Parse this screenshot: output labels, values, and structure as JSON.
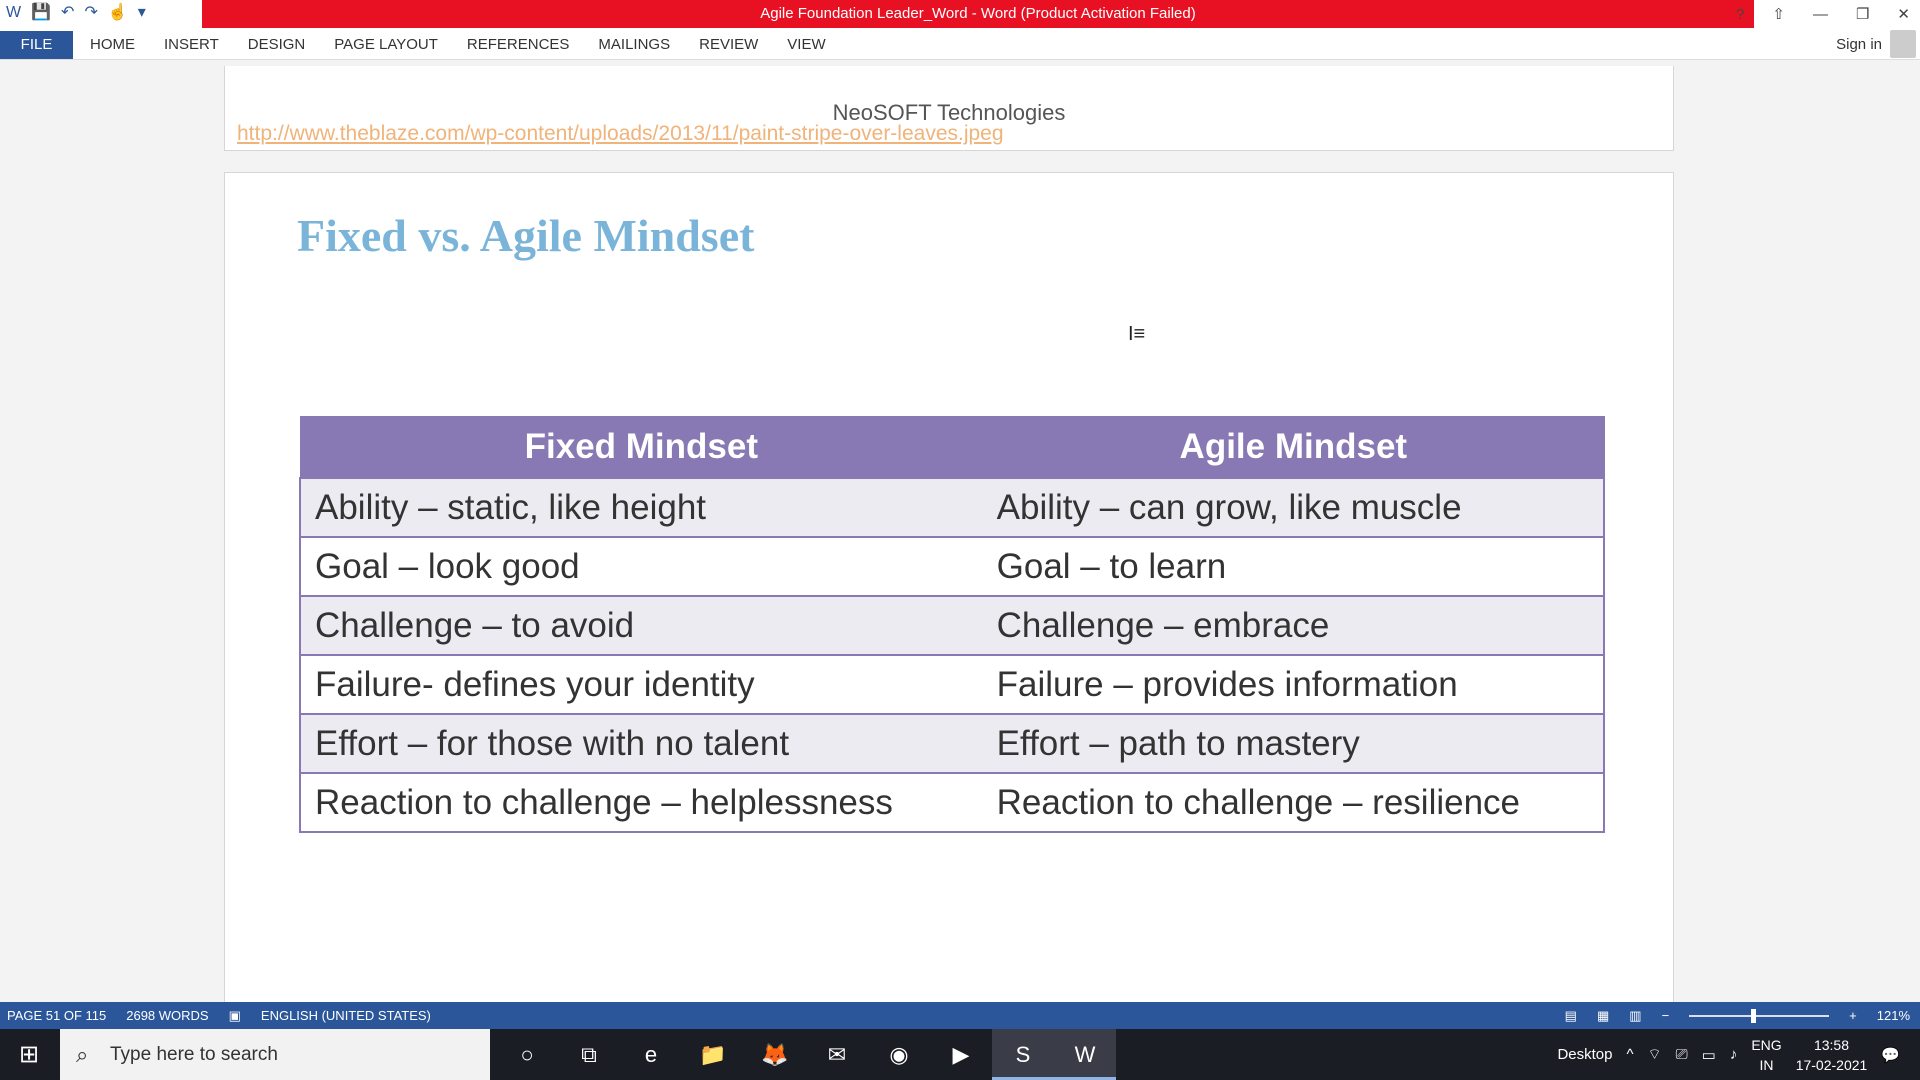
{
  "titlebar": {
    "title": "Agile Foundation Leader_Word -  Word (Product Activation Failed)",
    "help": "?",
    "minimize": "—",
    "restore": "❐",
    "close": "✕"
  },
  "ribbon": {
    "file": "FILE",
    "tabs": [
      "HOME",
      "INSERT",
      "DESIGN",
      "PAGE LAYOUT",
      "REFERENCES",
      "MAILINGS",
      "REVIEW",
      "VIEW"
    ],
    "signin": "Sign in"
  },
  "prev_page": {
    "org": "NeoSOFT Technologies",
    "link": "http://www.theblaze.com/wp-content/uploads/2013/11/paint-stripe-over-leaves.jpeg"
  },
  "page": {
    "heading": "Fixed vs. Agile Mindset",
    "table": {
      "headers": [
        "Fixed Mindset",
        "Agile Mindset"
      ],
      "rows": [
        [
          "Ability – static, like height",
          "Ability – can grow, like muscle"
        ],
        [
          "Goal – look good",
          "Goal – to learn"
        ],
        [
          "Challenge – to avoid",
          "Challenge – embrace"
        ],
        [
          "Failure-  defines your identity",
          "Failure – provides information"
        ],
        [
          "Effort – for those with no talent",
          "Effort – path to mastery"
        ],
        [
          "Reaction to challenge – helplessness",
          "Reaction to challenge – resilience"
        ]
      ]
    }
  },
  "statusbar": {
    "page": "PAGE 51 OF 115",
    "words": "2698 WORDS",
    "language": "ENGLISH (UNITED STATES)",
    "zoom": "121%",
    "zoom_level_fraction": 0.46
  },
  "taskbar": {
    "search_placeholder": "Type here to search",
    "desktop": "Desktop",
    "lang_top": "ENG",
    "lang_bottom": "IN",
    "time": "13:58",
    "date": "17-02-2021",
    "apps": [
      "cortana-icon",
      "task-view-icon",
      "edge-icon",
      "file-explorer-icon",
      "firefox-icon",
      "outlook-icon",
      "chrome-icon",
      "zoom-icon",
      "skype-icon",
      "word-icon"
    ]
  }
}
